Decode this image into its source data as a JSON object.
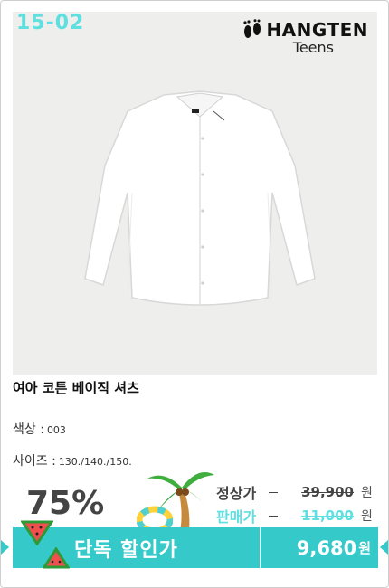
{
  "product_code": "15-02",
  "brand": {
    "name": "HANGTEN",
    "sub": "Teens"
  },
  "product": {
    "name": "여아 코튼 베이직 셔츠"
  },
  "color": {
    "label": "색상 :",
    "value": "003"
  },
  "size": {
    "label": "사이즈 :",
    "value": "130./140./150."
  },
  "discount_rate": "75%",
  "prices": {
    "regular_label": "정상가",
    "regular_value": "39,900",
    "sale_label": "판매가",
    "sale_value": "11,000",
    "currency": "원"
  },
  "promo": {
    "label": "단독 할인가",
    "final_price": "9,680",
    "currency": "원"
  },
  "colors": {
    "accent": "#36c9c9",
    "code": "#5ee0e0",
    "regular_label": "#444444",
    "sale_label": "#5ee0e0"
  }
}
